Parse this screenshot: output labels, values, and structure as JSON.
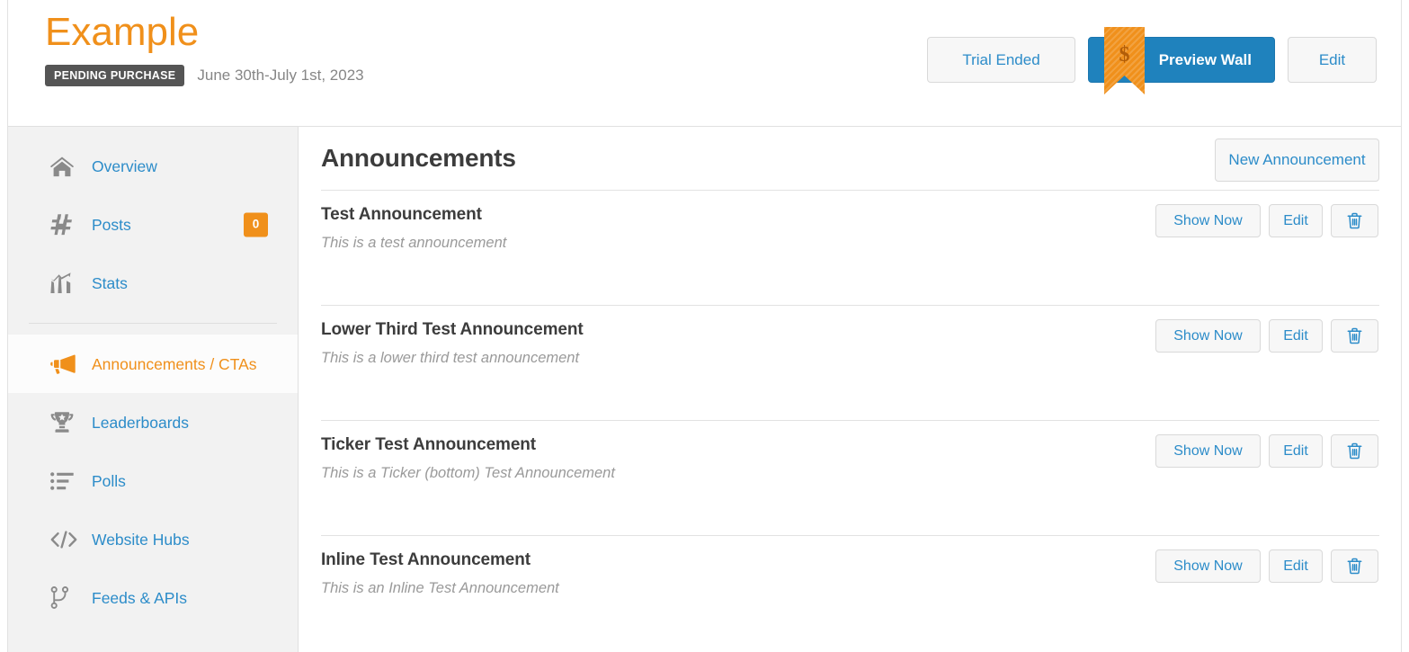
{
  "header": {
    "brand_title": "Example",
    "status_badge": "PENDING PURCHASE",
    "date_range": "June 30th-July 1st, 2023",
    "trial_button": "Trial Ended",
    "preview_button": "Preview Wall",
    "preview_ribbon_glyph": "$",
    "edit_button": "Edit",
    "accent_color": "#f0901b",
    "link_color": "#2c8cc9",
    "primary_button_color": "#1f82bd"
  },
  "sidebar": {
    "items": [
      {
        "label": "Overview",
        "icon": "home-icon",
        "badge": null,
        "active": false
      },
      {
        "label": "Posts",
        "icon": "hash-icon",
        "badge": "0",
        "active": false
      },
      {
        "label": "Stats",
        "icon": "bar-chart-icon",
        "badge": null,
        "active": false
      },
      {
        "label": "Announcements / CTAs",
        "icon": "megaphone-icon",
        "badge": null,
        "active": true
      },
      {
        "label": "Leaderboards",
        "icon": "trophy-icon",
        "badge": null,
        "active": false
      },
      {
        "label": "Polls",
        "icon": "list-icon",
        "badge": null,
        "active": false
      },
      {
        "label": "Website Hubs",
        "icon": "code-icon",
        "badge": null,
        "active": false
      },
      {
        "label": "Feeds & APIs",
        "icon": "code-branch-icon",
        "badge": null,
        "active": false
      }
    ]
  },
  "main": {
    "title": "Announcements",
    "new_button": "New Announcement",
    "row_actions": {
      "show_now": "Show Now",
      "edit": "Edit",
      "delete_icon": "trash-icon"
    },
    "announcements": [
      {
        "title": "Test Announcement",
        "description": "This is a test announcement"
      },
      {
        "title": "Lower Third Test Announcement",
        "description": "This is a lower third test announcement"
      },
      {
        "title": "Ticker Test Announcement",
        "description": "This is a Ticker (bottom) Test Announcement"
      },
      {
        "title": "Inline Test Announcement",
        "description": "This is an Inline Test Announcement"
      }
    ]
  }
}
